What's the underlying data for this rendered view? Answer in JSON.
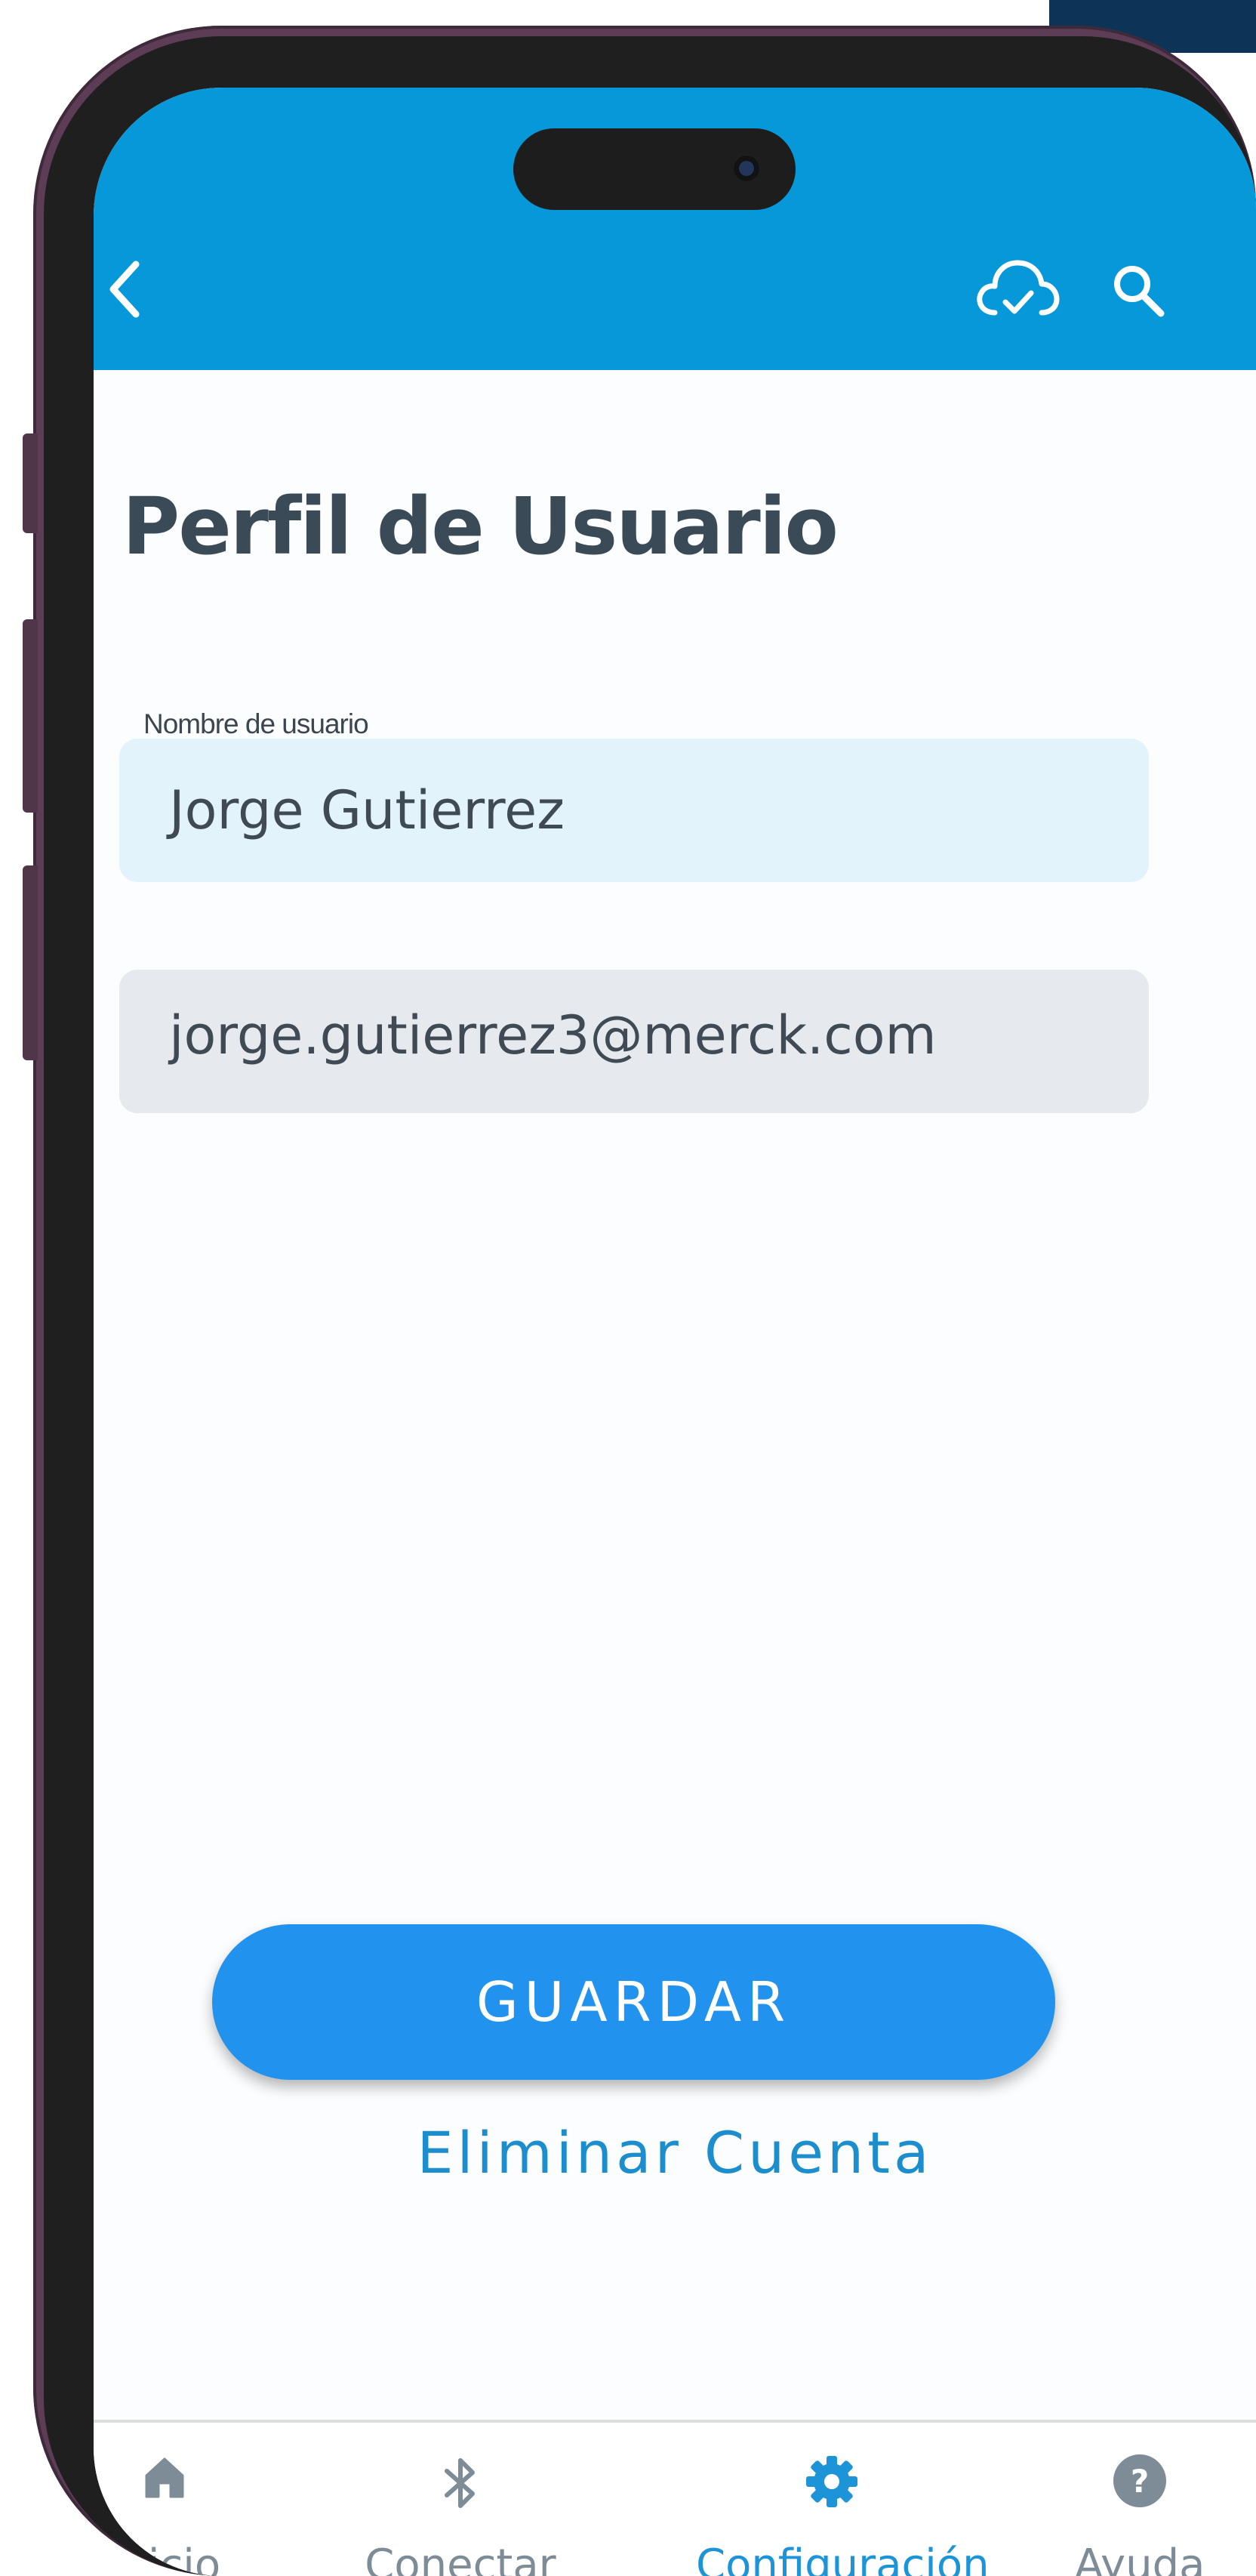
{
  "header": {
    "back_icon": "chevron-left-icon",
    "sync_icon": "cloud-check-icon",
    "search_icon": "search-icon"
  },
  "page": {
    "title": "Perfil de Usuario"
  },
  "form": {
    "username_label": "Nombre de usuario",
    "username_value": "Jorge Gutierrez",
    "email_value": "jorge.gutierrez3@merck.com"
  },
  "actions": {
    "save_label": "GUARDAR",
    "delete_label": "Eliminar Cuenta"
  },
  "bottom_nav": {
    "items": [
      {
        "label": "Inicio",
        "icon": "home-icon",
        "active": false
      },
      {
        "label": "Conectar",
        "icon": "bluetooth-icon",
        "active": false
      },
      {
        "label": "Configuración",
        "icon": "gear-icon",
        "active": true
      },
      {
        "label": "Ayuda",
        "icon": "help-circle-icon",
        "active": false
      }
    ]
  },
  "colors": {
    "header": "#0798d9",
    "accent": "#2193ee",
    "link": "#1c8ece",
    "nav_active": "#1e94d8",
    "nav_inactive": "#7d8c97",
    "title": "#3a4a56"
  }
}
